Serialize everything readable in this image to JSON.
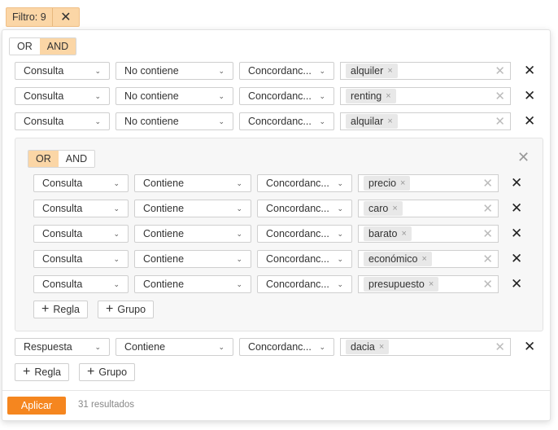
{
  "filter_chip": {
    "label": "Filtro: 9"
  },
  "root": {
    "or": "OR",
    "and": "AND",
    "active": "AND",
    "rules_before": [
      {
        "field": "Consulta",
        "operator": "No contiene",
        "match": "Concordanc...",
        "tags": [
          "alquiler"
        ]
      },
      {
        "field": "Consulta",
        "operator": "No contiene",
        "match": "Concordanc...",
        "tags": [
          "renting"
        ]
      },
      {
        "field": "Consulta",
        "operator": "No contiene",
        "match": "Concordanc...",
        "tags": [
          "alquilar"
        ]
      }
    ],
    "rules_after": [
      {
        "field": "Respuesta",
        "operator": "Contiene",
        "match": "Concordanc...",
        "tags": [
          "dacia"
        ]
      }
    ],
    "add_rule": "Regla",
    "add_group": "Grupo"
  },
  "group": {
    "or": "OR",
    "and": "AND",
    "active": "OR",
    "rules": [
      {
        "field": "Consulta",
        "operator": "Contiene",
        "match": "Concordanc...",
        "tags": [
          "precio"
        ]
      },
      {
        "field": "Consulta",
        "operator": "Contiene",
        "match": "Concordanc...",
        "tags": [
          "caro"
        ]
      },
      {
        "field": "Consulta",
        "operator": "Contiene",
        "match": "Concordanc...",
        "tags": [
          "barato"
        ]
      },
      {
        "field": "Consulta",
        "operator": "Contiene",
        "match": "Concordanc...",
        "tags": [
          "económico"
        ]
      },
      {
        "field": "Consulta",
        "operator": "Contiene",
        "match": "Concordanc...",
        "tags": [
          "presupuesto"
        ]
      }
    ],
    "add_rule": "Regla",
    "add_group": "Grupo"
  },
  "footer": {
    "apply": "Aplicar",
    "results": "31 resultados"
  }
}
